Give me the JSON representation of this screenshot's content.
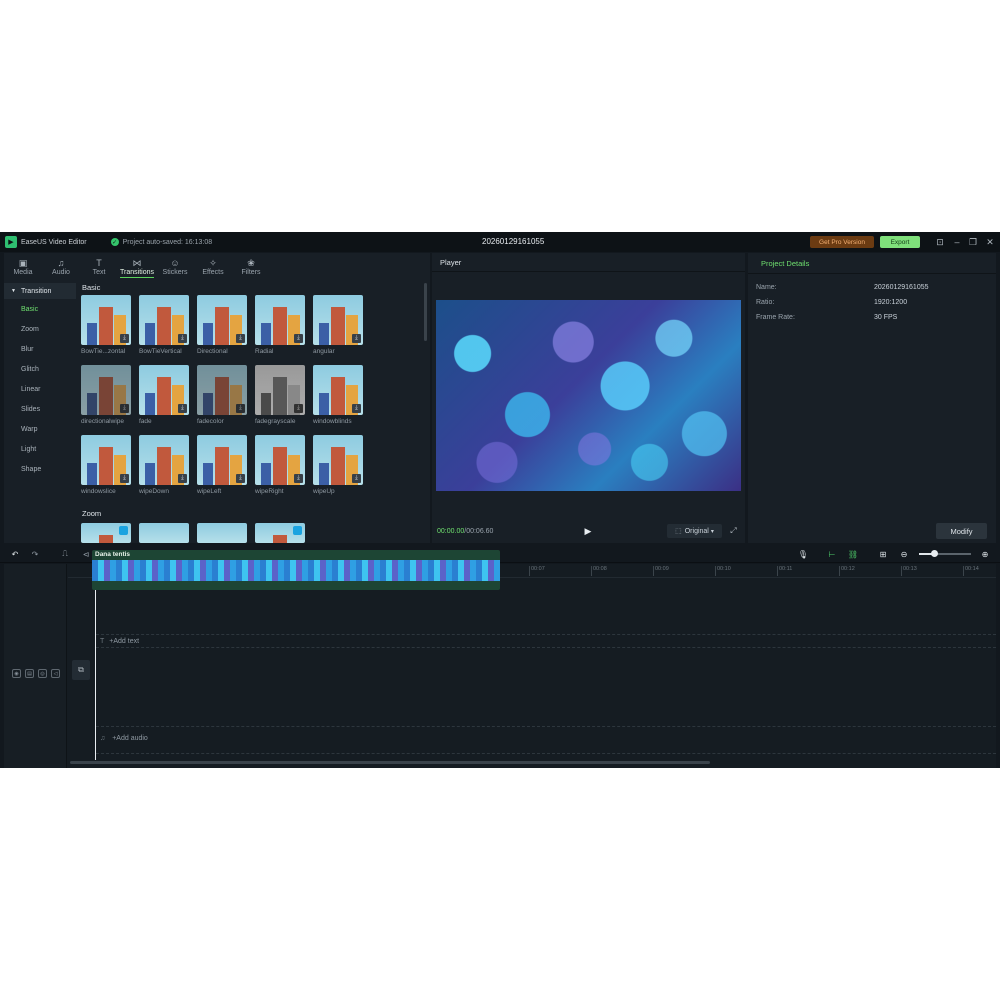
{
  "titlebar": {
    "app_name": "EaseUS Video Editor",
    "autosave": "Project auto-saved: 16:13:08",
    "doc_title": "20260129161055",
    "pro_button": "Get Pro Version",
    "export_button": "Export"
  },
  "tabs": [
    {
      "label": "Media",
      "icon": "media-icon"
    },
    {
      "label": "Audio",
      "icon": "audio-icon"
    },
    {
      "label": "Text",
      "icon": "text-icon"
    },
    {
      "label": "Transitions",
      "icon": "transitions-icon",
      "active": true
    },
    {
      "label": "Stickers",
      "icon": "stickers-icon"
    },
    {
      "label": "Effects",
      "icon": "effects-icon"
    },
    {
      "label": "Filters",
      "icon": "filters-icon"
    }
  ],
  "categories": {
    "header": "Transition",
    "items": [
      "Basic",
      "Zoom",
      "Blur",
      "Glitch",
      "Linear",
      "Slides",
      "Warp",
      "Light",
      "Shape"
    ],
    "active": "Basic"
  },
  "library": {
    "basic_title": "Basic",
    "zoom_title": "Zoom",
    "basic_items": [
      "BowTie...zontal",
      "BowTieVertical",
      "Directional",
      "Radial",
      "angular",
      "directionalwipe",
      "fade",
      "fadecolor",
      "fadegrayscale",
      "windowblinds",
      "windowslice",
      "wipeDown",
      "wipeLeft",
      "wipeRight",
      "wipeUp"
    ]
  },
  "player": {
    "title": "Player",
    "current_time": "00:00.00",
    "total_time": "/00:06.60",
    "ratio_option": "Original"
  },
  "details": {
    "title": "Project Details",
    "name_label": "Name:",
    "name_value": "20260129161055",
    "ratio_label": "Ratio:",
    "ratio_value": "1920:1200",
    "fps_label": "Frame Rate:",
    "fps_value": "30 FPS",
    "modify_button": "Modify"
  },
  "timeline": {
    "ticks": [
      "00:00",
      "00:01",
      "00:02",
      "00:03",
      "00:04",
      "00:05",
      "00:06",
      "00:07",
      "00:08",
      "00:09",
      "00:10",
      "00:11",
      "00:12",
      "00:13",
      "00:14"
    ],
    "add_text": "+Add text",
    "add_audio": "+Add audio",
    "clip_title": "Dana tentis"
  },
  "colors": {
    "accent_green": "#6fe06f",
    "export_green": "#7fe07b",
    "pro_orange": "#6b3b12",
    "background": "#12181e"
  }
}
